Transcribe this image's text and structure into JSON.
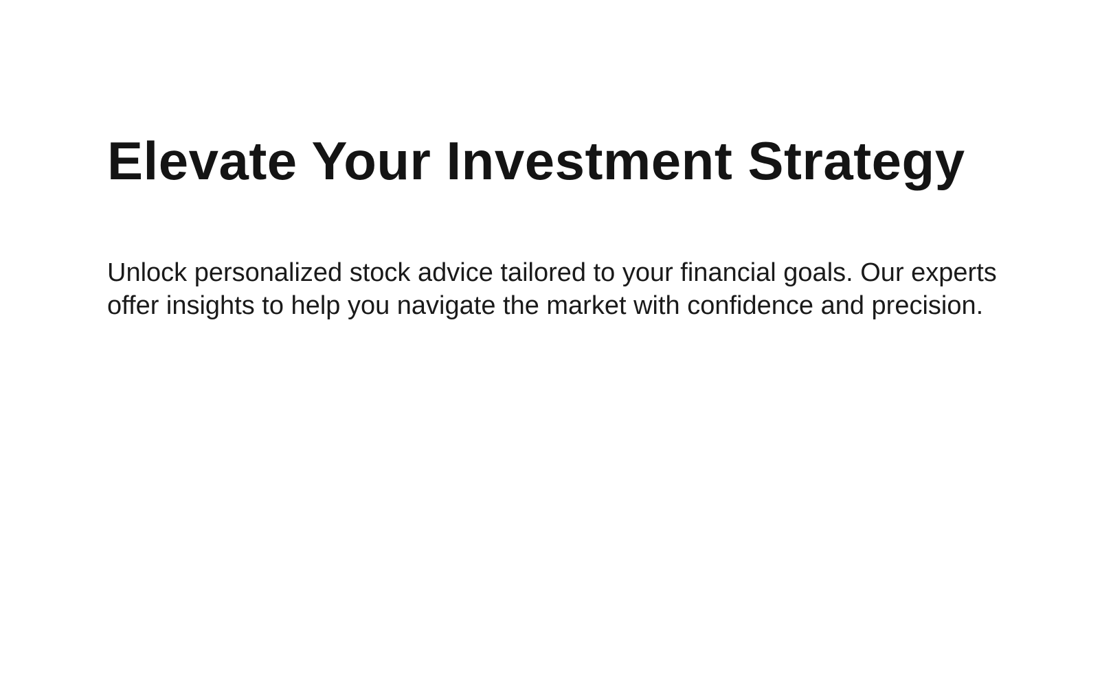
{
  "hero": {
    "title": "Elevate Your Investment Strategy",
    "description": "Unlock personalized stock advice tailored to your financial goals. Our experts offer insights to help you navigate the market with confidence and precision."
  },
  "colors": {
    "background": "#ffffff",
    "title": "#141414",
    "text": "#1a1a1a"
  }
}
